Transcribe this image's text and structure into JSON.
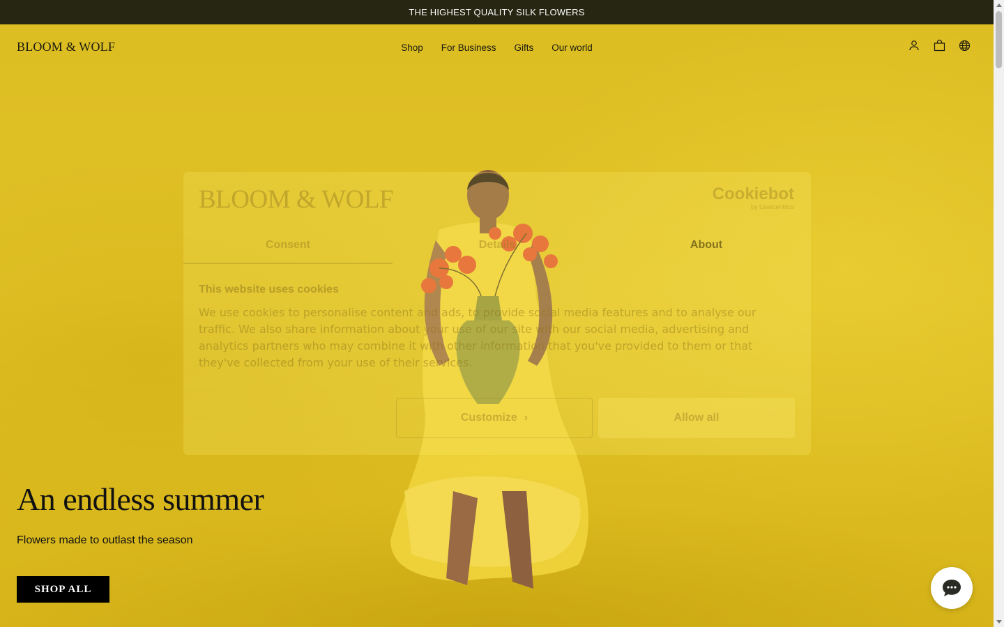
{
  "announcement": {
    "text": "THE HIGHEST QUALITY SILK FLOWERS"
  },
  "header": {
    "logo": "BLOOM & WOLF",
    "nav": [
      "Shop",
      "For Business",
      "Gifts",
      "Our world"
    ],
    "icons": [
      "account-icon",
      "bag-icon",
      "globe-icon"
    ]
  },
  "cookie_dialog": {
    "logo": "BLOOM & WOLF",
    "provider": "Cookiebot",
    "provider_sub": "by Usercentrics",
    "tabs": [
      "Consent",
      "Details",
      "About"
    ],
    "title": "This website uses cookies",
    "body": "We use cookies to personalise content and ads, to provide social media features and to analyse our traffic. We also share information about your use of our site with our social media, advertising and analytics partners who may combine it with other information that you've provided to them or that they've collected from your use of their services.",
    "customize_label": "Customize",
    "allow_label": "Allow all"
  },
  "hero": {
    "title": "An endless summer",
    "subtitle": "Flowers made to outlast the season",
    "cta": "SHOP ALL"
  },
  "colors": {
    "announce_bg": "#262612",
    "hero_bg": "#e2c21c",
    "cta_bg": "#000000"
  }
}
